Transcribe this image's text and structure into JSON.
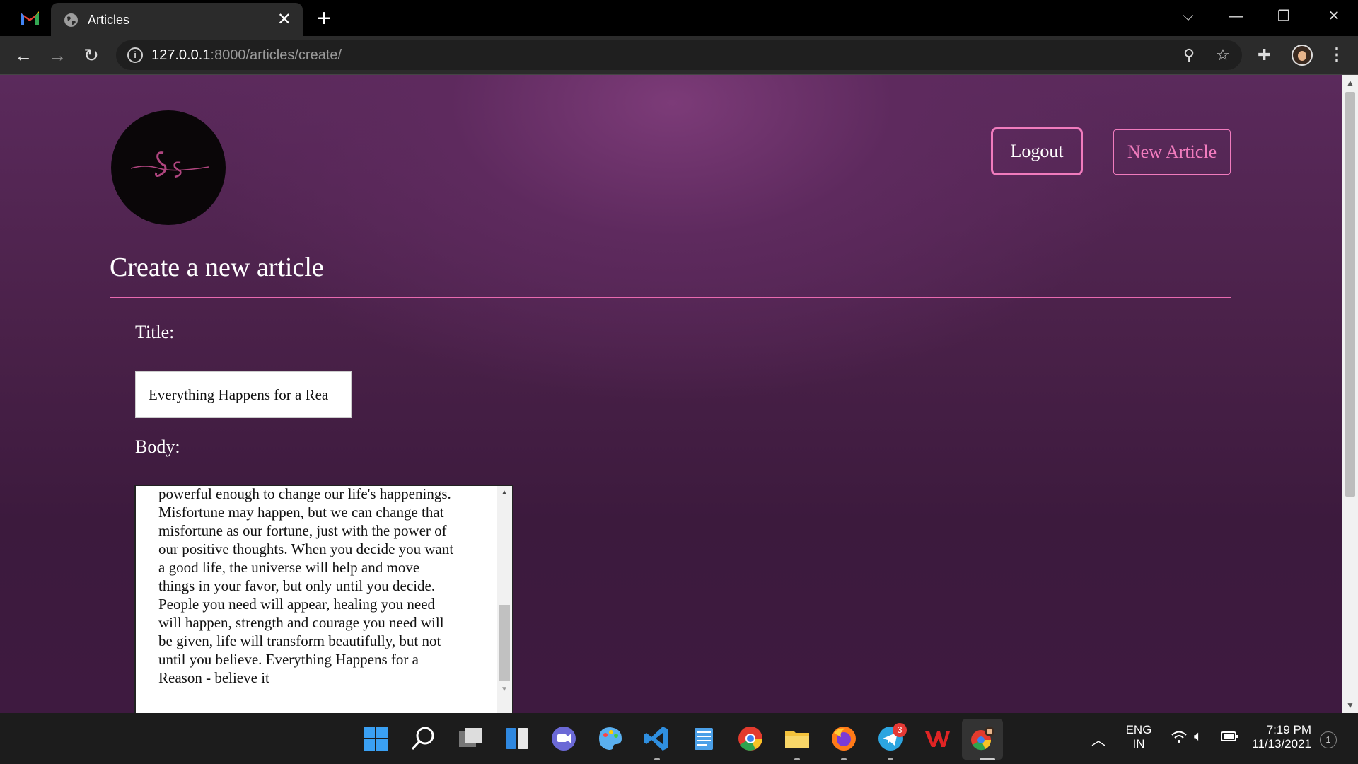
{
  "browser": {
    "tab_title": "Articles",
    "url_host": "127.0.0.1",
    "url_path": ":8000/articles/create/"
  },
  "header": {
    "logout_label": "Logout",
    "new_article_label": "New Article"
  },
  "page": {
    "title": "Create a new article"
  },
  "form": {
    "title_label": "Title:",
    "title_value": "Everything Happens for a Rea",
    "body_label": "Body:",
    "body_value": "positive thoughts. When our thoughts are, they are\npowerful enough to change our life's happenings.\nMisfortune may happen, but we can change that\nmisfortune as our fortune, just with the power of\nour positive thoughts. When you decide you want\na good life, the universe will help and move\nthings in your favor, but only until you decide.\nPeople you need will appear, healing you need\nwill happen, strength and courage you need will\nbe given, life will transform beautifully, but not\nuntil you believe. Everything Happens for a\nReason - believe it"
  },
  "taskbar": {
    "telegram_badge": "3",
    "language": "ENG",
    "region": "IN",
    "time": "7:19 PM",
    "date": "11/13/2021",
    "notification_count": "1"
  },
  "colors": {
    "accent_pink": "#f07bbd",
    "page_purple": "#4a2149"
  }
}
